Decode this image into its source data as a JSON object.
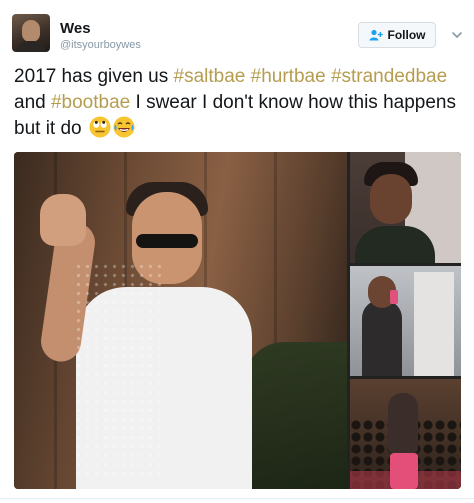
{
  "header": {
    "name": "Wes",
    "handle": "@itsyourboywes",
    "follow_label": "Follow"
  },
  "tweet": {
    "text_parts": [
      "2017 has given us ",
      "#saltbae",
      " ",
      "#hurtbae",
      " ",
      "#strandedbae",
      " and ",
      "#bootbae",
      " I swear I don't know how this happens but it do "
    ],
    "emojis": [
      "rolling-eyes-emoji",
      "laughing-tears-emoji"
    ]
  },
  "media": {
    "photos": [
      "salt-bae-photo",
      "smiling-woman-photo",
      "stranded-mirror-selfie-photo",
      "boots-crowd-photo"
    ]
  },
  "colors": {
    "hashtag": "#b59d50",
    "follow_icon": "#1da1f2",
    "handle": "#8899a6"
  },
  "icons": [
    "add-user-icon",
    "chevron-down-icon"
  ]
}
